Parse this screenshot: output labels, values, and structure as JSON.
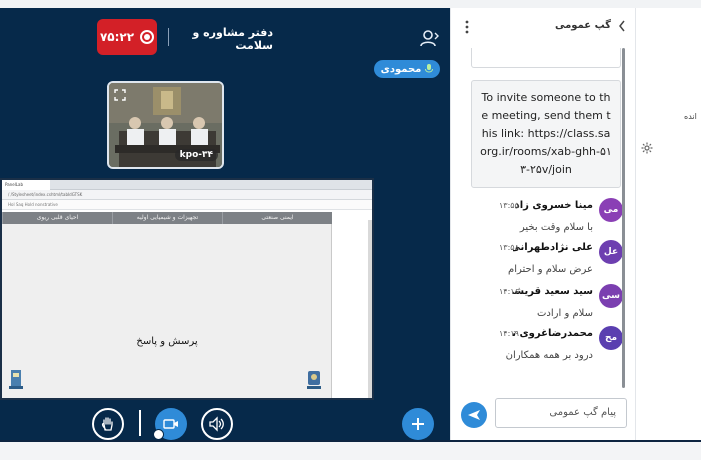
{
  "meeting": {
    "timer": "۷۵:۲۲",
    "title": "دفتر مشاوره و سلامت",
    "presenter": "محمودی",
    "webcam_name": "kpo-۳۴"
  },
  "slide": {
    "tabs": [
      "ایمنی صنعتی",
      "تجهیزات و شیمیایی اولیه",
      "احیای قلبی ریوی"
    ],
    "center_text": "پرسش و پاسخ",
    "browser_tab": "PanelLab",
    "browser_address": "/ /Stylesheet/index.cshtml/tabIdGTSK",
    "browser_toolbar": "Hol  Saq  Hold  nonstrative"
  },
  "chat": {
    "title": "گپ عمومی",
    "invite_text": "To invite someone to the meeting, send them this link: https://class.saorg.ir/rooms/xab-ghh-۵۱۳-۲۵v/join",
    "messages": [
      {
        "initials": "می",
        "name": "مینا خسروی زاد",
        "time": "۱۳:۵۵",
        "text": "با سلام وقت بخیر",
        "color": "#8a3fb5"
      },
      {
        "initials": "عل",
        "name": "علی نژادطهرانی(ال...",
        "time": "۱۳:۵۸",
        "text": "عرض سلام و احترام",
        "color": "#6d3fb0"
      },
      {
        "initials": "سی",
        "name": "سید سعید قریشی...",
        "time": "۱۴:۱۶",
        "text": "سلام و ارادت",
        "color": "#7b3fb0"
      },
      {
        "initials": "مح",
        "name": "محمدرضاغروی نو...",
        "time": "۱۴:۱۹",
        "text": "درود بر همه همکاران",
        "color": "#5a3fb0"
      }
    ],
    "input_placeholder": "پیام گپ عمومی"
  },
  "settings": {
    "label": "انده"
  },
  "colors": {
    "stage_bg": "#06294a",
    "accent": "#2f8bd8",
    "record_red": "#d32027"
  }
}
